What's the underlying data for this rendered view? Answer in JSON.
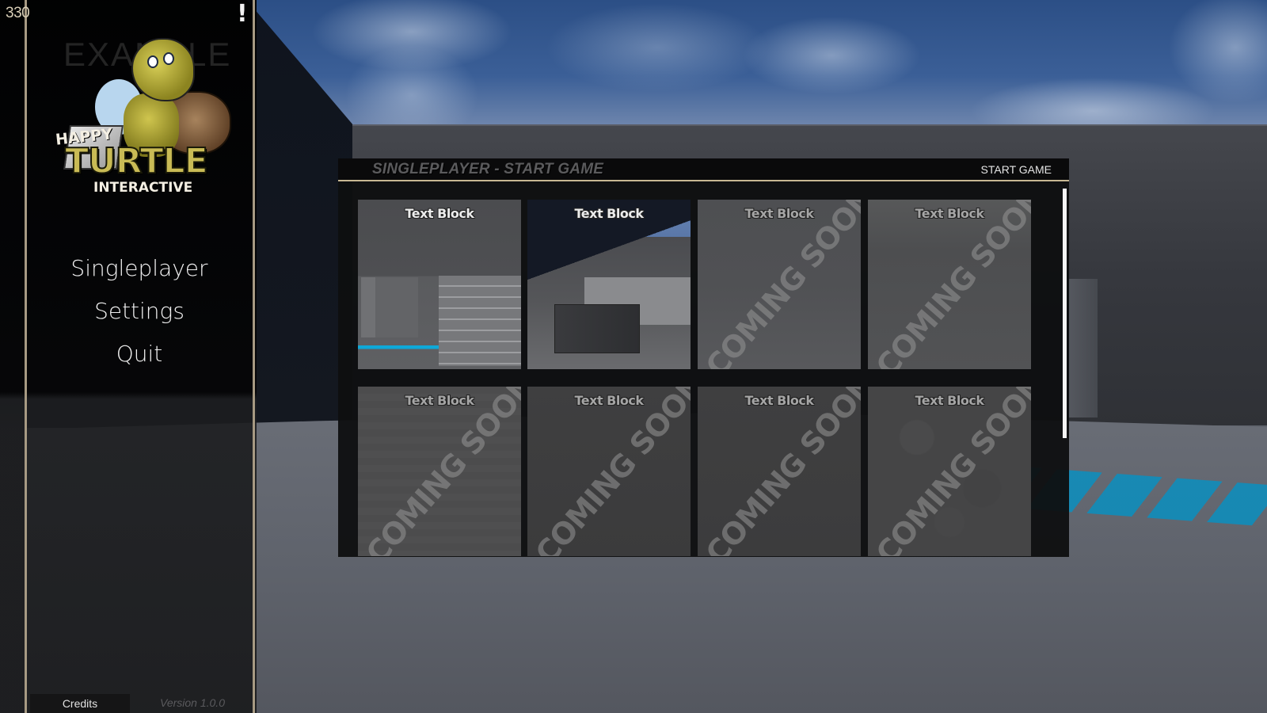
{
  "hud": {
    "fps_counter": "330",
    "alert_icon": "exclamation-icon",
    "alert_glyph": "!"
  },
  "logo": {
    "watermark": "EXAMPLE",
    "line1": "HAPPY",
    "line2": "TURTLE",
    "line3": "INTERACTIVE"
  },
  "main_menu": {
    "items": [
      {
        "label": "Singleplayer"
      },
      {
        "label": "Settings"
      },
      {
        "label": "Quit"
      }
    ]
  },
  "footer": {
    "credits_label": "Credits",
    "version_label": "Version 1.0.0"
  },
  "panel": {
    "title": "SINGLEPLAYER - START GAME",
    "start_game_label": "START GAME",
    "cards": [
      {
        "title": "Text Block",
        "overlay": "",
        "state": "available"
      },
      {
        "title": "Text Block",
        "overlay": "",
        "state": "available"
      },
      {
        "title": "Text Block",
        "overlay": "COMING SOON",
        "state": "locked"
      },
      {
        "title": "Text Block",
        "overlay": "COMING SOON",
        "state": "locked"
      },
      {
        "title": "Text Block",
        "overlay": "COMING SOON",
        "state": "locked"
      },
      {
        "title": "Text Block",
        "overlay": "COMING SOON",
        "state": "locked"
      },
      {
        "title": "Text Block",
        "overlay": "COMING SOON",
        "state": "locked"
      },
      {
        "title": "Text Block",
        "overlay": "COMING SOON",
        "state": "locked"
      }
    ]
  },
  "colors": {
    "accent_gold": "#c8b893",
    "floor_decal": "#0a8fbf",
    "sky": "#2c4f86"
  }
}
